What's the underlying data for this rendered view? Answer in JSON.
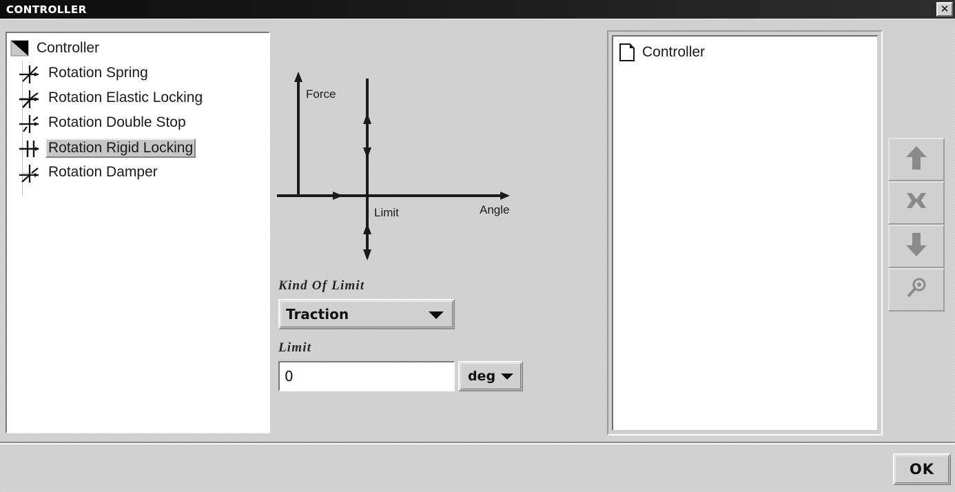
{
  "window": {
    "title": "CONTROLLER",
    "close_label": "✕",
    "close_icon": "close-icon"
  },
  "tree": {
    "root": {
      "label": "Controller",
      "icon": "folder-open-icon"
    },
    "items": [
      {
        "label": "Rotation Spring",
        "icon": "rotation-spring-icon",
        "selected": false
      },
      {
        "label": "Rotation Elastic Locking",
        "icon": "rotation-elastic-locking-icon",
        "selected": false
      },
      {
        "label": "Rotation Double Stop",
        "icon": "rotation-double-stop-icon",
        "selected": false
      },
      {
        "label": "Rotation Rigid Locking",
        "icon": "rotation-rigid-locking-icon",
        "selected": true
      },
      {
        "label": "Rotation Damper",
        "icon": "rotation-damper-icon",
        "selected": false
      }
    ]
  },
  "chart_data": {
    "type": "line",
    "title": "",
    "xlabel": "Angle",
    "ylabel": "Force",
    "annotations": [
      "Limit"
    ],
    "description": "Rigid locking characteristic: force axis vertical, angle axis horizontal, a vertical constraint line at the Limit angle with bidirectional arrows above and below the angle axis",
    "axes": [
      {
        "name": "Force",
        "orientation": "vertical",
        "arrow": "up",
        "label": "Force"
      },
      {
        "name": "Angle",
        "orientation": "horizontal",
        "arrow": "right",
        "label": "Angle"
      }
    ],
    "series": [
      {
        "name": "Limit line",
        "x": [
          0,
          0
        ],
        "y": [
          -1,
          1
        ],
        "style": "vertical-line-with-double-arrows",
        "label": "Limit"
      }
    ],
    "grid": false,
    "legend": "none"
  },
  "form": {
    "kind_of_limit": {
      "label": "Kind Of Limit",
      "value": "Traction",
      "arrow_icon": "chevron-down-icon"
    },
    "limit": {
      "label": "Limit",
      "value": "0",
      "placeholder": "",
      "unit": "deg",
      "unit_arrow_icon": "chevron-down-icon"
    }
  },
  "right_panel": {
    "items": [
      {
        "label": "Controller",
        "icon": "document-icon"
      }
    ]
  },
  "toolbar": {
    "buttons": [
      {
        "name": "move-up-button",
        "icon": "arrow-up-icon",
        "enabled": false
      },
      {
        "name": "delete-button",
        "icon": "close-x-icon",
        "enabled": false
      },
      {
        "name": "move-down-button",
        "icon": "arrow-down-icon",
        "enabled": false
      },
      {
        "name": "zoom-button",
        "icon": "magnifier-icon",
        "enabled": false
      }
    ]
  },
  "footer": {
    "ok_label": "OK"
  },
  "colors": {
    "titlebar": "#111111",
    "dialog_bg": "#d0d0d0",
    "panel_bg": "#ffffff",
    "selection_bg": "#c6c6c6",
    "disabled_icon": "#8a8a8a",
    "text": "#1a1a1a"
  }
}
